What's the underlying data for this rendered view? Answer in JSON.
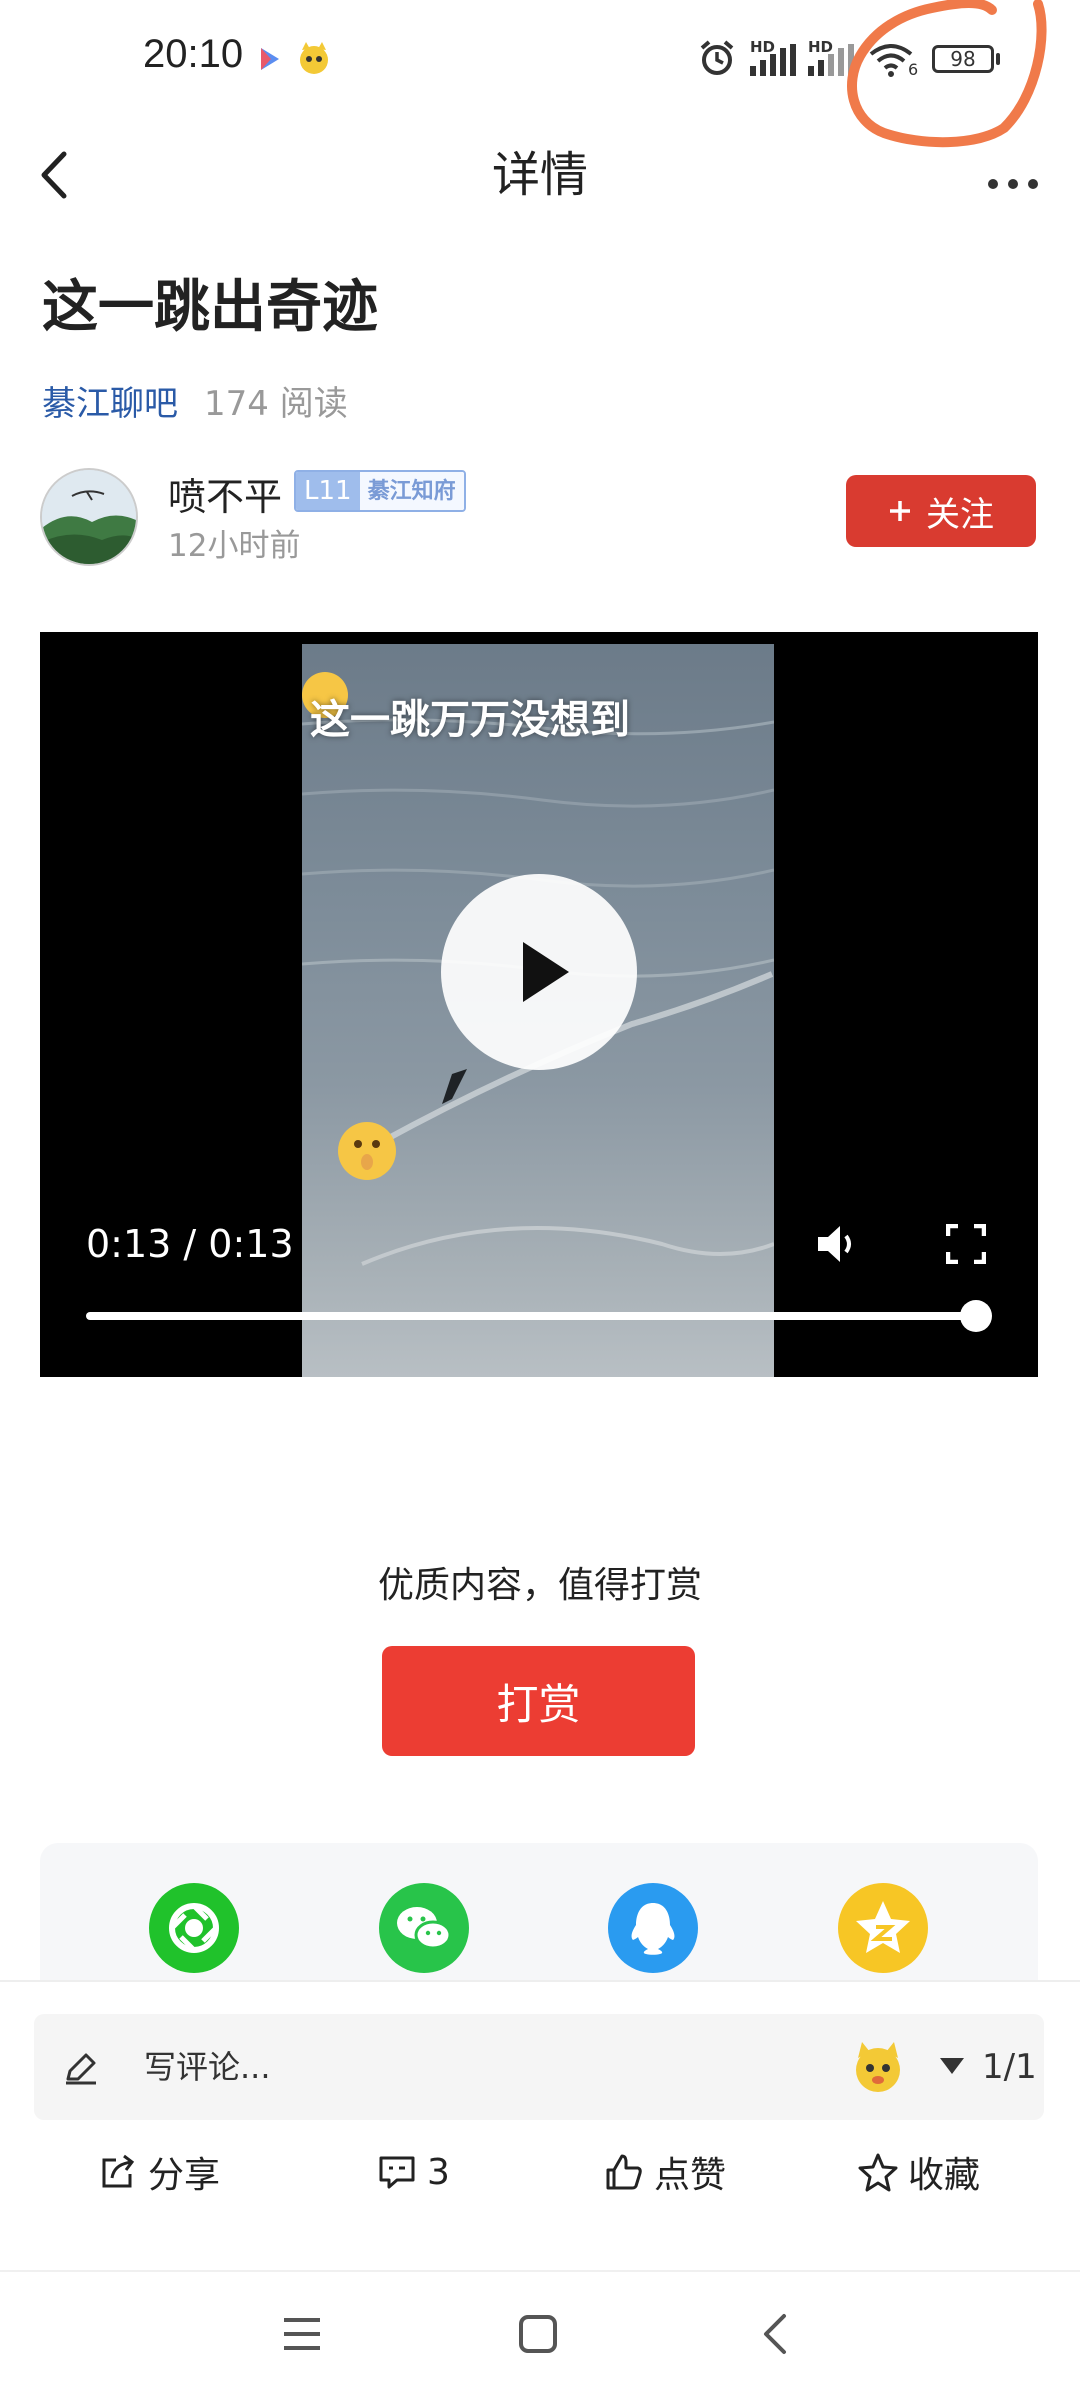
{
  "status_bar": {
    "time": "20:10",
    "battery": "98",
    "signal_labels": [
      "HD",
      "HD"
    ],
    "wifi_sub": "6",
    "icons": [
      "video-app-icon",
      "cat-app-icon",
      "alarm-icon",
      "signal-icon",
      "signal-icon",
      "wifi-icon",
      "battery-icon"
    ]
  },
  "header": {
    "title": "详情",
    "back_icon": "back-arrow-icon",
    "more_icon": "more-icon"
  },
  "post": {
    "title": "这一跳出奇迹",
    "forum": "綦江聊吧",
    "read_count": "174 阅读",
    "author": {
      "name": "喷不平",
      "level": "L11",
      "level_name": "綦江知府",
      "time": "12小时前"
    },
    "follow_label": "关注"
  },
  "video": {
    "caption": "这一跳万万没想到",
    "time": "0:13 / 0:13",
    "progress": 1.0
  },
  "reward": {
    "prompt": "优质内容，值得打赏",
    "button_label": "打赏"
  },
  "share": {
    "targets": [
      {
        "name": "moments",
        "color": "#20c22b"
      },
      {
        "name": "wechat",
        "color": "#28c44a"
      },
      {
        "name": "qq",
        "color": "#2a9bf0"
      },
      {
        "name": "qzone",
        "color": "#f7c625"
      }
    ]
  },
  "comment": {
    "placeholder": "写评论...",
    "page": "1/1"
  },
  "actions": {
    "share_label": "分享",
    "comment_count": "3",
    "like_label": "点赞",
    "favorite_label": "收藏"
  },
  "colors": {
    "accent_red": "#d93b30",
    "reward_red": "#ec3d33",
    "link_blue": "#2a5aa7",
    "annotation_orange": "#f07a4a"
  }
}
